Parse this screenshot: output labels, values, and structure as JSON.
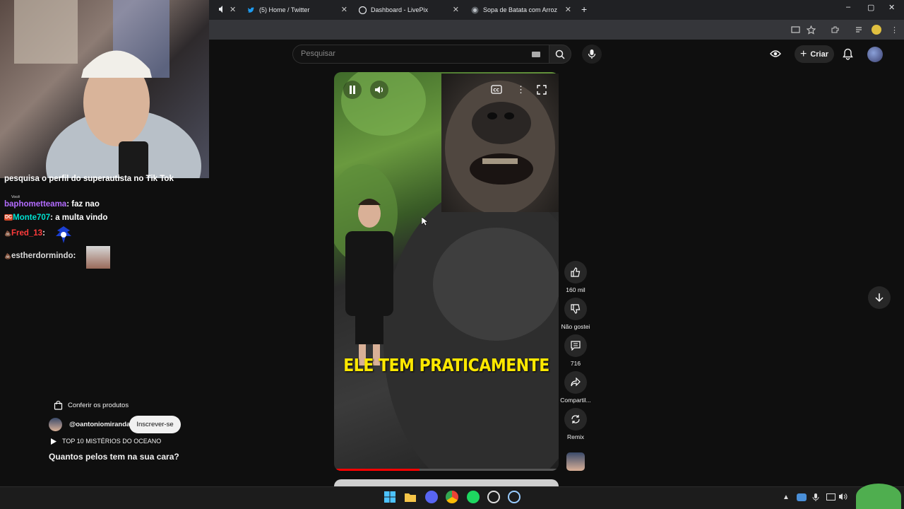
{
  "browser": {
    "tabs": [
      {
        "title": "(5) Home / Twitter",
        "icon": "twitter-icon"
      },
      {
        "title": "Dashboard - LivePix",
        "icon": "livepix-icon"
      },
      {
        "title": "Sopa de Batata com Arroz",
        "icon": "page-icon"
      }
    ],
    "new_tab": "+",
    "close_glyph": "✕",
    "window_controls": [
      "–",
      "▢",
      "✕"
    ]
  },
  "chat": {
    "pinned_text": "pesquisa o perfil do superautista no Tik Tok",
    "pinned_tag": "Você",
    "messages": [
      {
        "badge": "",
        "user": "baphometteama",
        "sep": ":",
        "text": "faz nao",
        "color": "#b36cff"
      },
      {
        "badge": "DC",
        "user": "Monte707",
        "sep": ":",
        "text": "a multa vindo",
        "color": "#00e0d0"
      },
      {
        "badge": "💩",
        "user": "Fred_13",
        "sep": ":",
        "text": "",
        "color": "#ff3b3b"
      },
      {
        "badge": "💩",
        "user": "estherdormindo",
        "sep": ":",
        "text": "",
        "color": "#d9d9d9"
      }
    ]
  },
  "youtube": {
    "search_placeholder": "Pesquisar",
    "create_label": "Criar",
    "video_caption": "ELE TEM PRATICAMENTE",
    "video_progress": 0.38,
    "actions": {
      "like_count": "160 mil",
      "dislike_label": "Não gostei",
      "comment_count": "716",
      "share_label": "Compartil...",
      "remix_label": "Remix"
    },
    "products_label": "Conferir os produtos",
    "channel": "@oantoniomiranda",
    "subscribe_label": "Inscrever-se",
    "playlist_label": "TOP 10 MISTÉRIOS DO OCEANO",
    "video_title": "Quantos pelos tem na sua cara?"
  },
  "colors": {
    "accent_red": "#ff0000",
    "caption_yellow": "#ffe800"
  }
}
